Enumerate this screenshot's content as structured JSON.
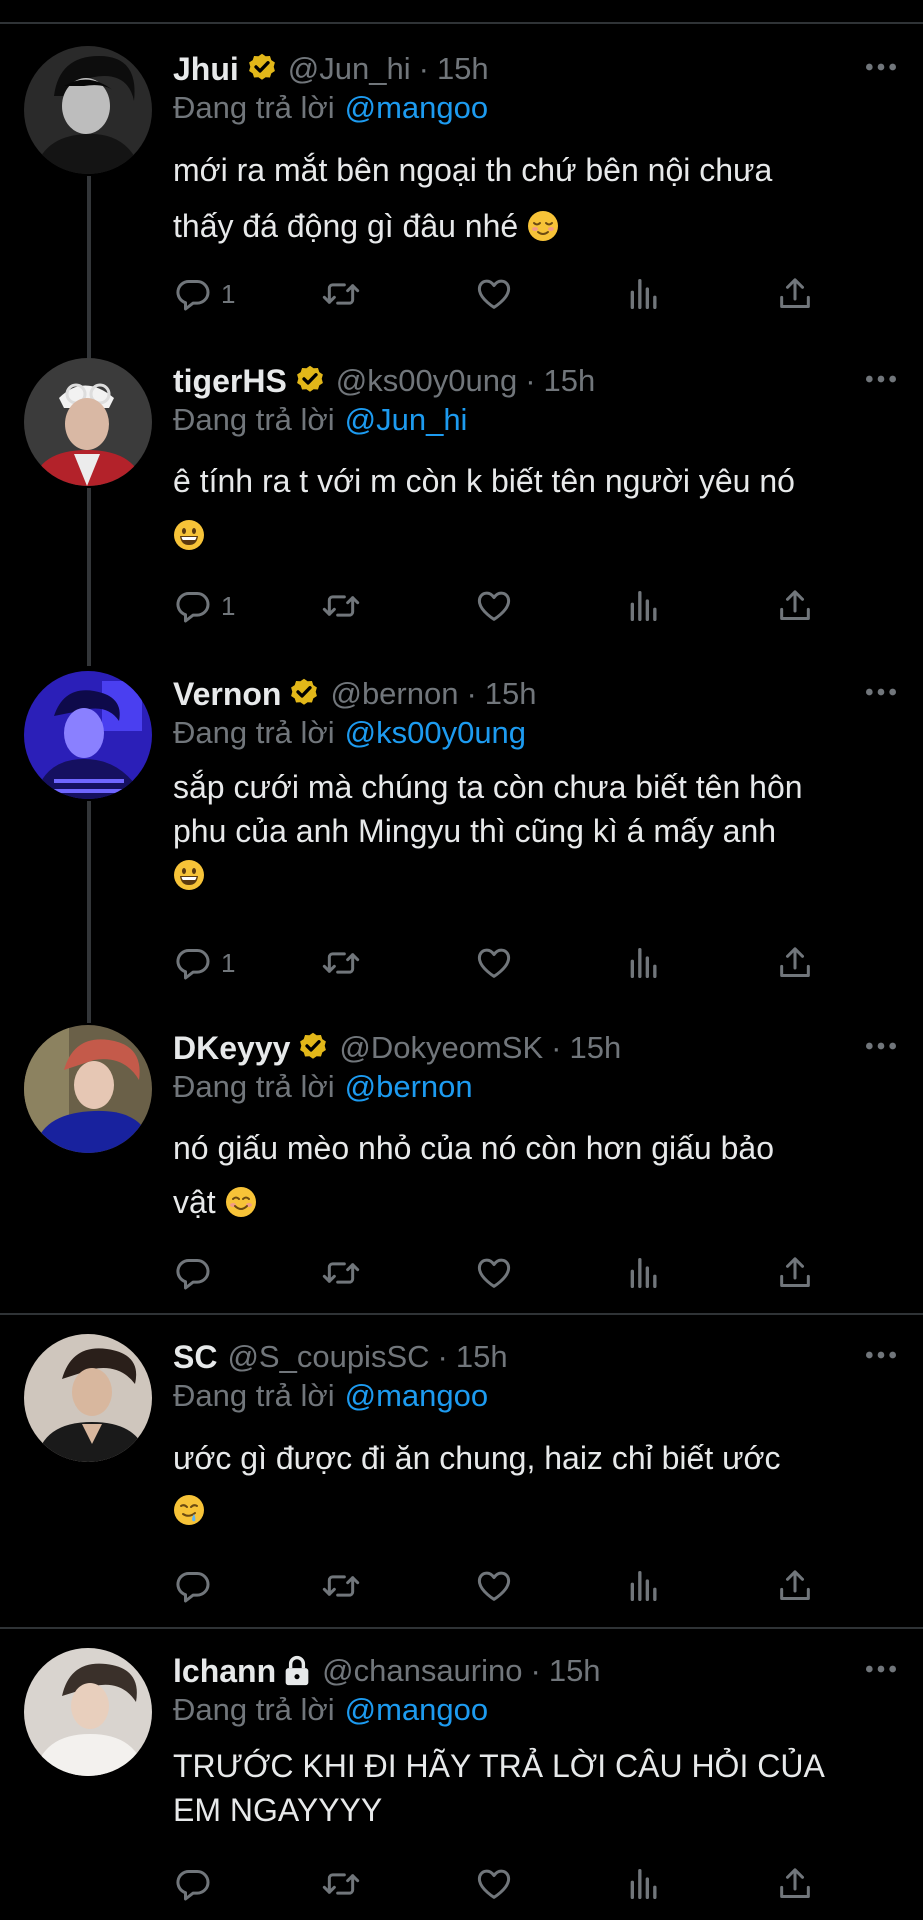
{
  "colors": {
    "background": "#000000",
    "text": "#e7e9ea",
    "secondary": "#71767b",
    "link": "#1d9bf0",
    "verified": "#e2b719"
  },
  "replying_prefix": "Đang trả lời",
  "tweets": [
    {
      "name": "Jhui",
      "badge": "gold-check-icon",
      "handle": "@Jun_hi",
      "time": "15h",
      "reply_to": "@mangoo",
      "lines": [
        "mới ra mắt bên ngoại th chứ bên nội chưa",
        "thấy đá động gì đâu nhé"
      ],
      "emoji": "relieved-face-emoji",
      "reply_count": "1"
    },
    {
      "name": "tigerHS",
      "badge": "gold-check-icon",
      "handle": "@ks00y0ung",
      "time": "15h",
      "reply_to": "@Jun_hi",
      "lines": [
        "ê tính ra t với m còn k biết tên người yêu nó",
        ""
      ],
      "emoji": "grinning-face-emoji",
      "reply_count": "1"
    },
    {
      "name": "Vernon",
      "badge": "gold-check-icon",
      "handle": "@bernon",
      "time": "15h",
      "reply_to": "@ks00y0ung",
      "lines": [
        "sắp cưới mà chúng ta còn chưa biết tên hôn",
        "phu của anh Mingyu thì cũng kì á mấy anh",
        ""
      ],
      "emoji": "grinning-face-emoji",
      "reply_count": "1"
    },
    {
      "name": "DKeyyy",
      "badge": "gold-check-icon",
      "handle": "@DokyeomSK",
      "time": "15h",
      "reply_to": "@bernon",
      "lines": [
        "nó giấu mèo nhỏ của nó còn hơn giấu bảo",
        "vật"
      ],
      "emoji": "smiling-face-emoji",
      "reply_count": ""
    },
    {
      "name": "SC",
      "badge": "",
      "handle": "@S_coupisSC",
      "time": "15h",
      "reply_to": "@mangoo",
      "lines": [
        "ước gì được đi ăn chung, haiz chỉ biết ước",
        ""
      ],
      "emoji": "drooling-face-emoji",
      "reply_count": ""
    },
    {
      "name": "lchann",
      "badge": "lock-icon",
      "handle": "@chansaurino",
      "time": "15h",
      "reply_to": "@mangoo",
      "lines": [
        "TRƯỚC KHI ĐI HÃY TRẢ LỜI CÂU HỎI CỦA",
        "EM NGAYYYY"
      ],
      "emoji": "",
      "reply_count": ""
    }
  ]
}
